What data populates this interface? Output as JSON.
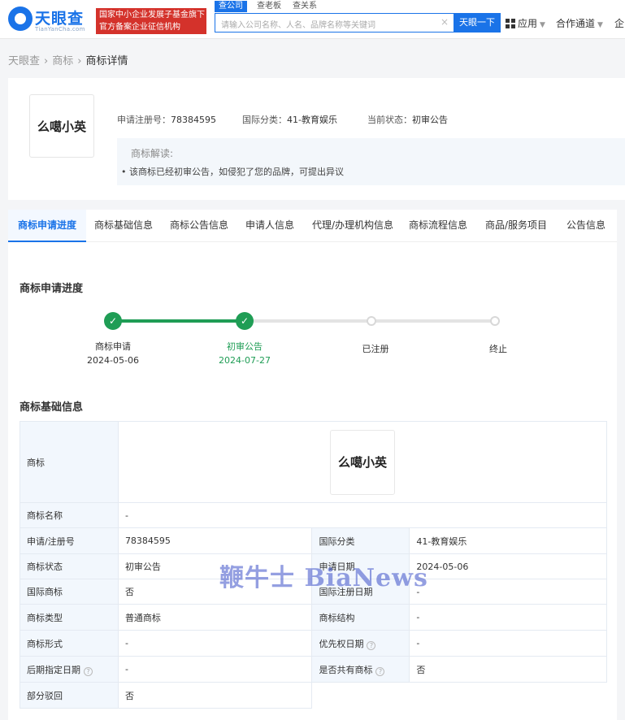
{
  "header": {
    "logo_name": "天眼查",
    "logo_sub": "TianYanCha.com",
    "slogan_line1": "国家中小企业发展子基金旗下",
    "slogan_line2": "官方备案企业征信机构",
    "search_tabs": [
      "查公司",
      "查老板",
      "查关系"
    ],
    "search_placeholder": "请输入公司名称、人名、品牌名称等关键词",
    "clear_icon": "×",
    "search_button": "天眼一下",
    "nav_apps": "应用",
    "nav_partner": "合作通道",
    "nav_enterprise": "企"
  },
  "breadcrumb": [
    "天眼查",
    "商标",
    "商标详情"
  ],
  "summary": {
    "trademark_text": "么噶小英",
    "reg_no_label": "申请注册号：",
    "reg_no": "78384595",
    "intl_class_label": "国际分类：",
    "intl_class": "41-教育娱乐",
    "status_label": "当前状态：",
    "status": "初审公告",
    "explain_title": "商标解读:",
    "explain_text": "•  该商标已经初审公告，如侵犯了您的品牌，可提出异议"
  },
  "tabs": [
    "商标申请进度",
    "商标基础信息",
    "商标公告信息",
    "申请人信息",
    "代理/办理机构信息",
    "商标流程信息",
    "商品/服务项目",
    "公告信息"
  ],
  "progress": {
    "title": "商标申请进度",
    "steps": [
      {
        "label": "商标申请",
        "date": "2024-05-06",
        "state": "done"
      },
      {
        "label": "初审公告",
        "date": "2024-07-27",
        "state": "current"
      },
      {
        "label": "已注册",
        "date": "",
        "state": "todo"
      },
      {
        "label": "终止",
        "date": "",
        "state": "todo"
      }
    ]
  },
  "basic": {
    "title": "商标基础信息",
    "trademark_label": "商标",
    "trademark_image_text": "么噶小英",
    "name_label": "商标名称",
    "name_value": "-",
    "rows": [
      {
        "k1": "申请/注册号",
        "v1": "78384595",
        "k2": "国际分类",
        "v2": "41-教育娱乐"
      },
      {
        "k1": "商标状态",
        "v1": "初审公告",
        "k2": "申请日期",
        "v2": "2024-05-06"
      },
      {
        "k1": "国际商标",
        "v1": "否",
        "k2": "国际注册日期",
        "v2": "-"
      },
      {
        "k1": "商标类型",
        "v1": "普通商标",
        "k2": "商标结构",
        "v2": "-"
      },
      {
        "k1": "商标形式",
        "v1": "-",
        "k2": "优先权日期",
        "v2": "-"
      },
      {
        "k1": "后期指定日期",
        "v1": "-",
        "k2": "是否共有商标",
        "v2": "否"
      }
    ],
    "last_label": "部分驳回",
    "last_value": "否"
  },
  "watermark": "鞭牛士 BiaNews",
  "colors": {
    "brand": "#1a73e8",
    "success": "#1f9d55",
    "slogan_bg": "#d4322b"
  }
}
